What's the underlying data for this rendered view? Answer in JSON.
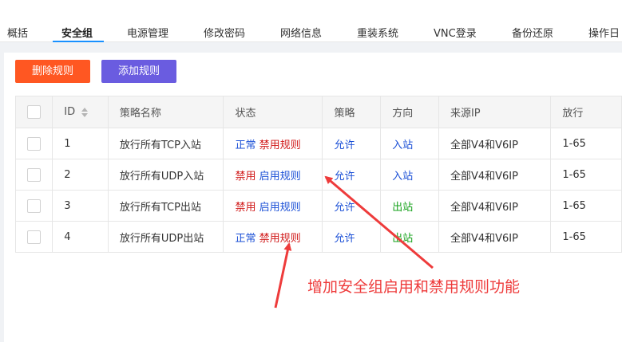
{
  "tabs": [
    "概括",
    "安全组",
    "电源管理",
    "修改密码",
    "网络信息",
    "重装系统",
    "VNC登录",
    "备份还原",
    "操作日"
  ],
  "active_tab": "安全组",
  "buttons": {
    "delete": "删除规则",
    "add": "添加规则"
  },
  "table": {
    "headers": [
      "ID",
      "策略名称",
      "状态",
      "策略",
      "方向",
      "来源IP",
      "放行"
    ],
    "rows": [
      {
        "id": "1",
        "name": "放行所有TCP入站",
        "status": "正常",
        "action": "禁用规则",
        "policy": "允许",
        "direction": "入站",
        "source": "全部V4和V6IP",
        "port": "1-65"
      },
      {
        "id": "2",
        "name": "放行所有UDP入站",
        "status": "禁用",
        "action": "启用规则",
        "policy": "允许",
        "direction": "入站",
        "source": "全部V4和V6IP",
        "port": "1-65"
      },
      {
        "id": "3",
        "name": "放行所有TCP出站",
        "status": "禁用",
        "action": "启用规则",
        "policy": "允许",
        "direction": "出站",
        "source": "全部V4和V6IP",
        "port": "1-65"
      },
      {
        "id": "4",
        "name": "放行所有UDP出站",
        "status": "正常",
        "action": "禁用规则",
        "policy": "允许",
        "direction": "出站",
        "source": "全部V4和V6IP",
        "port": "1-65"
      }
    ]
  },
  "annotation": "增加安全组启用和禁用规则功能",
  "colors": {
    "normal": "#1a4fd6",
    "disabled": "#d01818",
    "inbound": "#1a4fd6",
    "outbound": "#16a21b",
    "annotation": "#ee3b3b"
  }
}
